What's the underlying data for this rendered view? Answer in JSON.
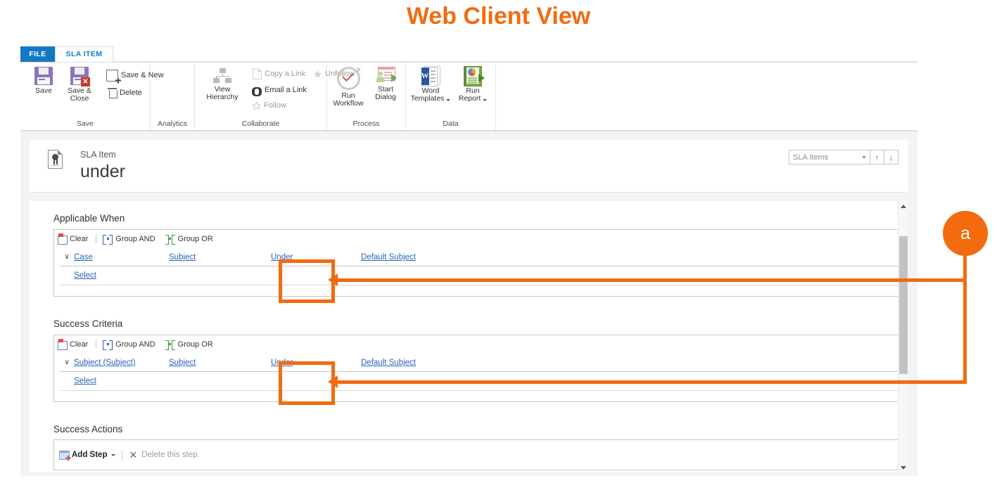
{
  "page": {
    "title": "Web Client View",
    "title_color": "#F26B0F"
  },
  "window": {
    "tabs": [
      {
        "label": "FILE",
        "active": false
      },
      {
        "label": "SLA ITEM",
        "active": true
      }
    ]
  },
  "ribbon": {
    "groups": [
      {
        "name": "Save",
        "label": "Save",
        "big_buttons": [
          {
            "label_line1": "Save",
            "label_line2": "",
            "icon": "save-floppy-icon"
          },
          {
            "label_line1": "Save &",
            "label_line2": "Close",
            "icon": "save-close-floppy-icon"
          }
        ],
        "small_buttons": [
          {
            "label": "Save & New",
            "icon": "save-new-icon"
          },
          {
            "label": "Delete",
            "icon": "trash-icon"
          }
        ]
      },
      {
        "name": "Analytics",
        "label": "Analytics",
        "big_buttons": [],
        "small_buttons": []
      },
      {
        "name": "Collaborate",
        "label": "Collaborate",
        "big_buttons": [
          {
            "label_line1": "View",
            "label_line2": "Hierarchy",
            "icon": "hierarchy-icon"
          }
        ],
        "small_buttons": [
          {
            "label": "Copy a Link",
            "icon": "page-icon"
          },
          {
            "label": "Email a Link",
            "icon": "link-icon"
          },
          {
            "label": "Follow",
            "icon": "star-outline-icon"
          },
          {
            "label": "Unfollow",
            "icon": "star-filled-icon"
          }
        ]
      },
      {
        "name": "Process",
        "label": "Process",
        "big_buttons": [
          {
            "label_line1": "Run",
            "label_line2": "Workflow",
            "icon": "run-workflow-icon"
          },
          {
            "label_line1": "Start",
            "label_line2": "Dialog",
            "icon": "start-dialog-icon"
          }
        ],
        "small_buttons": []
      },
      {
        "name": "Data",
        "label": "Data",
        "big_buttons": [
          {
            "label_line1": "Word",
            "label_line2": "Templates",
            "icon": "word-icon",
            "has_caret": true
          },
          {
            "label_line1": "Run",
            "label_line2": "Report",
            "icon": "run-report-icon",
            "has_caret": true
          }
        ],
        "small_buttons": []
      }
    ]
  },
  "record": {
    "entity_type": "SLA Item",
    "name": "under",
    "icon": "sla-item-record-icon",
    "view_selector": {
      "value": "SLA Items",
      "up_label": "↑",
      "down_label": "↓"
    }
  },
  "form": {
    "sections": [
      {
        "title": "Applicable When",
        "toolbar": [
          {
            "label": "Clear",
            "icon": "clear-icon"
          },
          {
            "label": "Group AND",
            "icon": "group-and-icon"
          },
          {
            "label": "Group OR",
            "icon": "group-or-icon"
          }
        ],
        "columns": [
          "entity",
          "field",
          "operator",
          "value"
        ],
        "rows": [
          {
            "chevron": "∨",
            "entity": "Case",
            "field": "Subject",
            "operator": "Under",
            "value": "Default Subject"
          }
        ],
        "select_label": "Select"
      },
      {
        "title": "Success Criteria",
        "toolbar": [
          {
            "label": "Clear",
            "icon": "clear-icon"
          },
          {
            "label": "Group AND",
            "icon": "group-and-icon"
          },
          {
            "label": "Group OR",
            "icon": "group-or-icon"
          }
        ],
        "columns": [
          "entity",
          "field",
          "operator",
          "value"
        ],
        "rows": [
          {
            "chevron": "∨",
            "entity": "Subject (Subject)",
            "field": "Subject",
            "operator": "Under",
            "value": "Default Subject"
          }
        ],
        "select_label": "Select"
      }
    ],
    "actions_section": {
      "title": "Success Actions",
      "add_step_label": "Add Step",
      "delete_step_label": "Delete this step."
    }
  },
  "annotation": {
    "marker_label": "a",
    "color": "#F26B0F"
  }
}
